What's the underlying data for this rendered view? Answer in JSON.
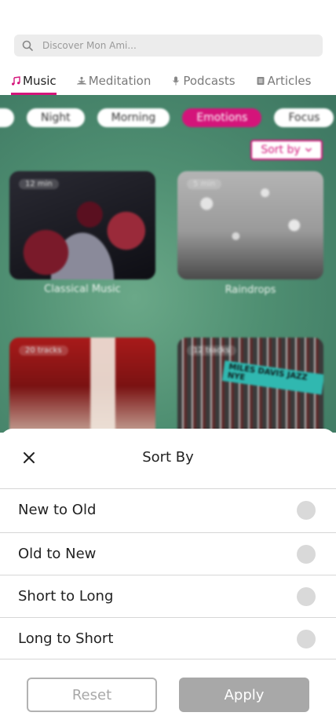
{
  "search": {
    "placeholder": "Discover Mon Ami..."
  },
  "tabs": [
    {
      "label": "Music",
      "icon": "music-note-icon",
      "active": true
    },
    {
      "label": "Meditation",
      "icon": "meditation-icon",
      "active": false
    },
    {
      "label": "Podcasts",
      "icon": "microphone-icon",
      "active": false
    },
    {
      "label": "Articles",
      "icon": "article-icon",
      "active": false
    }
  ],
  "chips": [
    {
      "label": ""
    },
    {
      "label": "Night"
    },
    {
      "label": "Morning"
    },
    {
      "label": "Emotions",
      "active": true
    },
    {
      "label": "Focus"
    }
  ],
  "sort_button": {
    "label": "Sort by"
  },
  "cards": [
    {
      "badge": "12 min",
      "title": "Classical Music"
    },
    {
      "badge": "5 min",
      "title": "Raindrops"
    },
    {
      "badge": "20 tracks",
      "title": ""
    },
    {
      "badge": "12 tracks",
      "title": "",
      "art_text": "MILES DAVIS JAZZ NYE"
    }
  ],
  "sheet": {
    "title": "Sort By",
    "options": [
      {
        "label": "New to Old"
      },
      {
        "label": "Old to New"
      },
      {
        "label": "Short to Long"
      },
      {
        "label": "Long to Short"
      }
    ],
    "reset_label": "Reset",
    "apply_label": "Apply"
  },
  "colors": {
    "accent": "#d4147a",
    "radio_unselected": "#d9d9d9",
    "apply_disabled": "#a8a8a8"
  }
}
